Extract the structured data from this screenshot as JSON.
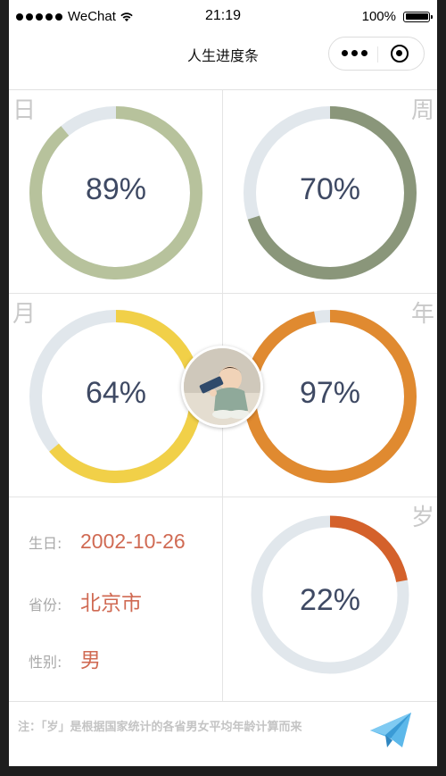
{
  "status_bar": {
    "carrier": "WeChat",
    "time": "21:19",
    "battery": "100%"
  },
  "nav": {
    "title": "人生进度条"
  },
  "progress": {
    "day": {
      "label": "日",
      "percent": 89,
      "text": "89%",
      "color": "#b7c29c"
    },
    "week": {
      "label": "周",
      "percent": 70,
      "text": "70%",
      "color": "#8a967a"
    },
    "month": {
      "label": "月",
      "percent": 64,
      "text": "64%",
      "color": "#f1d048"
    },
    "year": {
      "label": "年",
      "percent": 97,
      "text": "97%",
      "color": "#e08a30"
    },
    "age": {
      "label": "岁",
      "percent": 22,
      "text": "22%",
      "color": "#d4612b"
    }
  },
  "track_color": "#e1e7ec",
  "info": {
    "birthday_label": "生日:",
    "birthday_value": "2002-10-26",
    "province_label": "省份:",
    "province_value": "北京市",
    "gender_label": "性别:",
    "gender_value": "男"
  },
  "footer": {
    "note": "注：「岁」是根据国家统计的各省男女平均年龄计算而来"
  },
  "icons": {
    "share": "paper-plane-icon",
    "more": "more-dots-icon",
    "close": "target-close-icon"
  }
}
